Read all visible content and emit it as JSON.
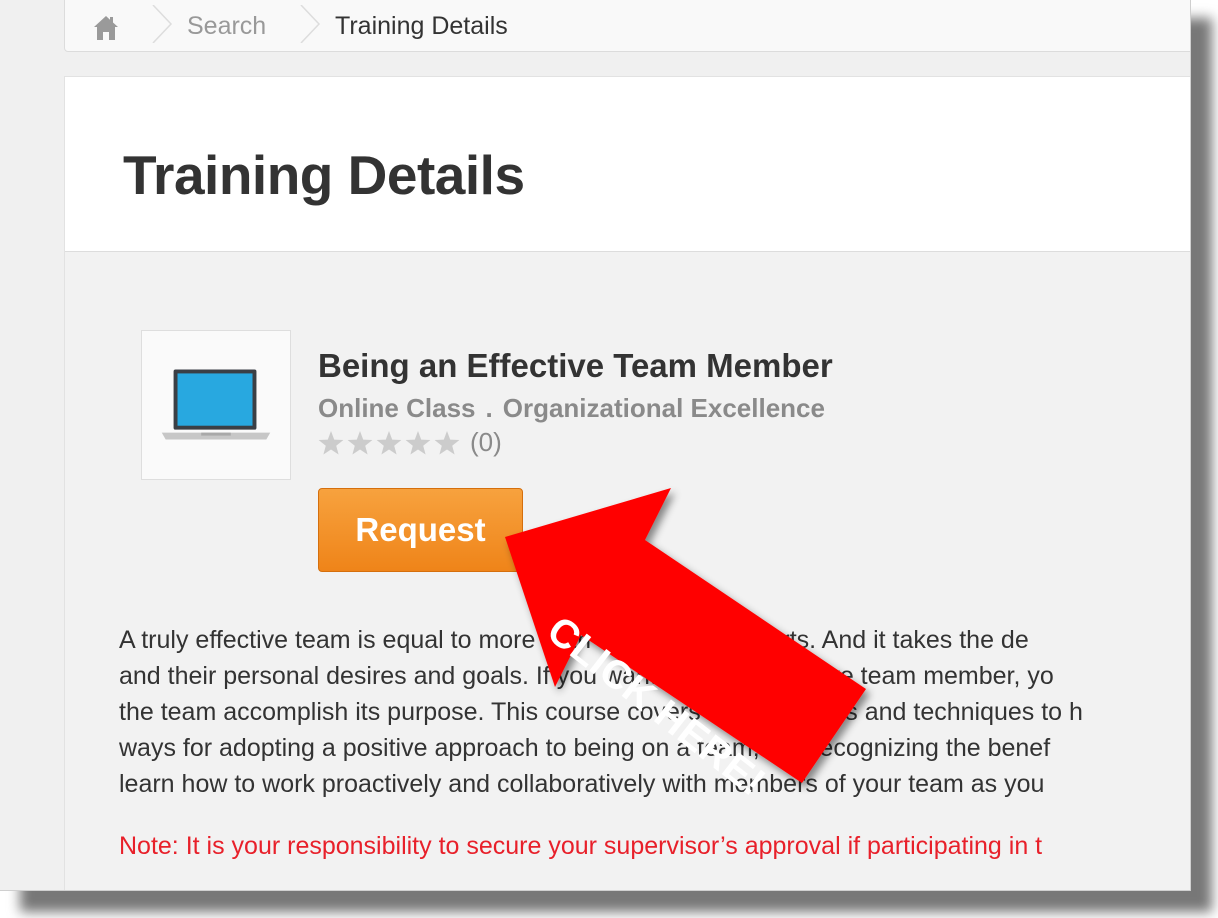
{
  "breadcrumb": {
    "home_icon": "home-icon",
    "items": [
      "Search",
      "Training Details"
    ]
  },
  "page": {
    "title": "Training Details"
  },
  "course": {
    "thumbnail_icon": "laptop-icon",
    "title": "Being an Effective Team Member",
    "type": "Online Class",
    "separator": ".",
    "category": "Organizational Excellence",
    "rating": {
      "stars": 0,
      "max_stars": 5,
      "count_label": "(0)"
    },
    "request_label": "Request"
  },
  "description": [
    "A truly effective team is equal to more than the sum of its parts. And it takes the de",
    "and their personal desires and goals. If you want to be an effective team member, yo",
    "the team accomplish its purpose. This course covers the strategies and techniques to h",
    "ways for adopting a positive approach to being on a team, like recognizing the benef",
    "learn how to work proactively and collaboratively with members of your team as you"
  ],
  "note": "Note: It is your responsibility to secure your supervisor’s approval if participating in t",
  "callout": {
    "label": "CLICK HERE!",
    "color": "#ff0000"
  },
  "colors": {
    "accent_button": "#f08a1f",
    "note_text": "#e8202a",
    "star_inactive": "#cccccc"
  }
}
